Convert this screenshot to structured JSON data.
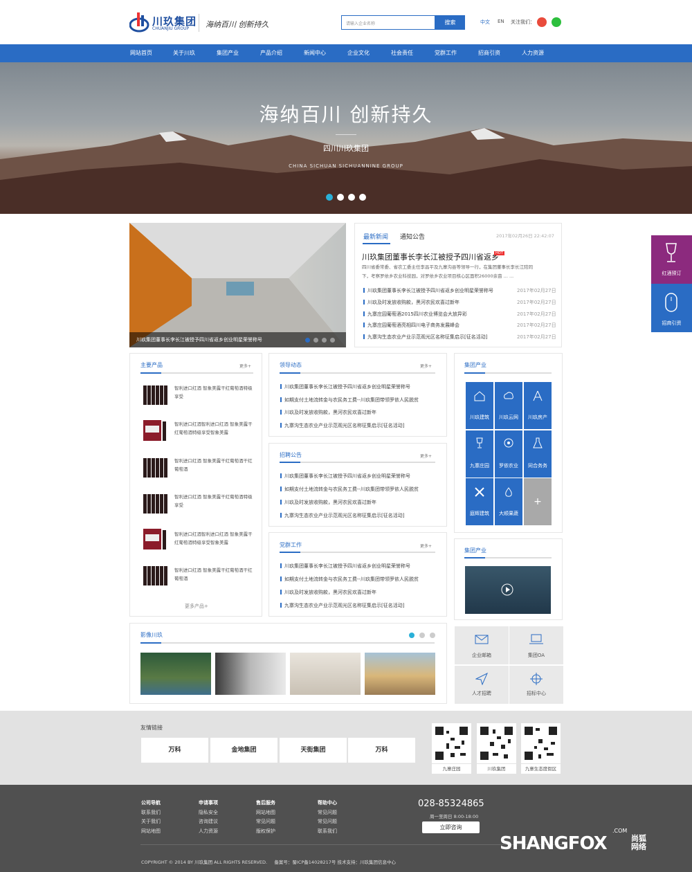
{
  "header": {
    "logo_cn": "川玖集团",
    "logo_en": "CHUANJIU GROUP",
    "slogan": "海纳百川  创新持久",
    "search_placeholder": "请输入企业名称",
    "search_button": "搜索",
    "lang_cn": "中文",
    "lang_en": "EN",
    "follow": "关注我们："
  },
  "nav": [
    "网站首页",
    "关于川玖",
    "集团产业",
    "产品介绍",
    "新闻中心",
    "企业文化",
    "社会责任",
    "党群工作",
    "招商引资",
    "人力资源"
  ],
  "banner": {
    "title": "海纳百川  创新持久",
    "subtitle": "四川川玖集团",
    "english": "CHINA  SICHUAN  SICHUANNINE  GROUP"
  },
  "feature": {
    "caption": "川玖集团董事长李长江被授予四川省返乡创业明星荣誉称号"
  },
  "news": {
    "tab1": "最新新闻",
    "tab2": "通知公告",
    "datetime": "2017年02月26日  22:42:07",
    "headline": "川玖集团董事长李长江被授予四川省返乡",
    "hot": "HOT",
    "summary1": "四川省委常委、省农工委主任李昌平及九寨沟县等领导一行，在集团董事长李长江陪同",
    "summary2": "下，考察罗依乡农业科技园，对罗依乡农业项目核心区面积26000余亩 ... ...",
    "items": [
      {
        "t": "川玖集团董事长李长江被授予四川省返乡创业明星荣誉称号",
        "d": "2017年02月27日"
      },
      {
        "t": "川玖及时发放收购款，黑河农民欢喜过新年",
        "d": "2017年02月27日"
      },
      {
        "t": "九寨庄园葡萄酒2015四川农业博览会大放异彩",
        "d": "2017年02月27日"
      },
      {
        "t": "九寨庄园葡萄酒亮相四川电子商务发展峰会",
        "d": "2017年02月27日"
      },
      {
        "t": "九寨沟生态农业产业示范观光区名称征集启示[征名活动]",
        "d": "2017年02月27日"
      }
    ]
  },
  "products": {
    "title": "主要产品",
    "more": "更多+",
    "items": [
      "智利进口红酒 智象美露干红葡萄酒特级享受",
      "智利进口红酒智利进口红酒 智象美露干红葡萄酒特级享受智象美露",
      "智利进口红酒 智象美露干红葡萄酒干红葡萄酒",
      "智利进口红酒 智象美露干红葡萄酒特级享受",
      "智利进口红酒智利进口红酒 智象美露干红葡萄酒特级享受智象美露",
      "智利进口红酒 智象美露干红葡萄酒干红葡萄酒"
    ],
    "more_products": "更多产品+"
  },
  "leaders": {
    "title": "领导动态",
    "more": "更多+",
    "items": [
      "川玖集团董事长李长江被授予四川省返乡创业明星荣誉称号",
      "如期支付土地流转金与农民务工费--川玖集团带领罗依人民脱贫",
      "川玖及时发放收购款，黑河农民欢喜过新年",
      "九寨沟生态农业产业示范观光区名称征集启示[征名活动]"
    ]
  },
  "recruit": {
    "title": "招聘公告",
    "more": "更多+",
    "items": [
      "川玖集团董事长李长江被授予四川省返乡创业明星荣誉称号",
      "如期支付土地流转金与农民务工费--川玖集团带领罗依人民脱贫",
      "川玖及时发放收购款，黑河农民欢喜过新年",
      "九寨沟生态农业产业示范观光区名称征集启示[征名活动]"
    ]
  },
  "party": {
    "title": "党群工作",
    "more": "更多+",
    "items": [
      "川玖集团董事长李长江被授予四川省返乡创业明星荣誉称号",
      "如期支付土地流转金与农民务工费--川玖集团带领罗依人民脱贫",
      "川玖及时发放收购款，黑河农民欢喜过新年",
      "九寨沟生态农业产业示范观光区名称征集启示[征名活动]"
    ]
  },
  "industry": {
    "title": "集团产业",
    "items": [
      "川玖建筑",
      "川玖云网",
      "川玖房产",
      "九寨庄园",
      "罗依农业",
      "同合务务",
      "庭辉建筑",
      "大顺果蔬"
    ],
    "plus": "+"
  },
  "industry2": {
    "title": "集团产业"
  },
  "video": {
    "title": "影像川玖"
  },
  "quick": [
    "企业邮箱",
    "集团OA",
    "人才招聘",
    "招标中心"
  ],
  "links": {
    "title": "友情链接",
    "items": [
      "万科",
      "金地集团",
      "天街集团",
      "万科"
    ],
    "qr": [
      "九寨庄园",
      "川玖集团",
      "九寨生态度假区"
    ]
  },
  "footer": {
    "cols": [
      {
        "h": "公司导航",
        "i": [
          "联系我们",
          "关于我们",
          "网站地图"
        ]
      },
      {
        "h": "申请事项",
        "i": [
          "隐私安全",
          "咨询建议",
          "人力资源"
        ]
      },
      {
        "h": "售后服务",
        "i": [
          "网站地图",
          "常见问题",
          "版权保护"
        ]
      },
      {
        "h": "帮助中心",
        "i": [
          "常见问题",
          "常见问题",
          "联系我们"
        ]
      }
    ],
    "phone": "028-85324865",
    "hours": "周一至周日 8:00-18:00",
    "consult": "立即咨询",
    "copyright": "COPYRIGHT © 2014 BY 川玖集团 ALL RIGHTS RESERVED.     备案号：蜀ICP备14028217号 技术支持：川玖集团信息中心",
    "watermark": "SHANGFOX",
    "watermark_cn": "尚狐网络",
    "watermark_com": ".COM"
  },
  "side": [
    "红酒预订",
    "招商引资"
  ]
}
